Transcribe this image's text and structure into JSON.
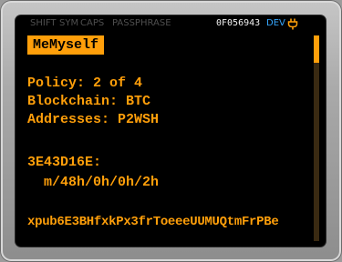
{
  "status": {
    "shift": "SHIFT",
    "sym": "SYM",
    "caps": "CAPS",
    "passphrase": "PASSPHRASE",
    "fingerprint": "0F056943",
    "mode": "DEV",
    "power_icon": "plug-icon"
  },
  "title": "MeMyself",
  "details": {
    "policy": "Policy: 2 of 4",
    "blockchain": "Blockchain: BTC",
    "addresses": "Addresses: P2WSH",
    "cosigner_fingerprint": "3E43D16E:",
    "derivation_path": "m/48h/0h/0h/2h",
    "xpub": "xpub6E3BHfxkPx3frToeeeUUMUQtmFrPBe"
  },
  "scroll": {
    "position": 0
  },
  "colors": {
    "accent": "#ff9f0a",
    "dev": "#36a7ff",
    "background": "#000000"
  }
}
